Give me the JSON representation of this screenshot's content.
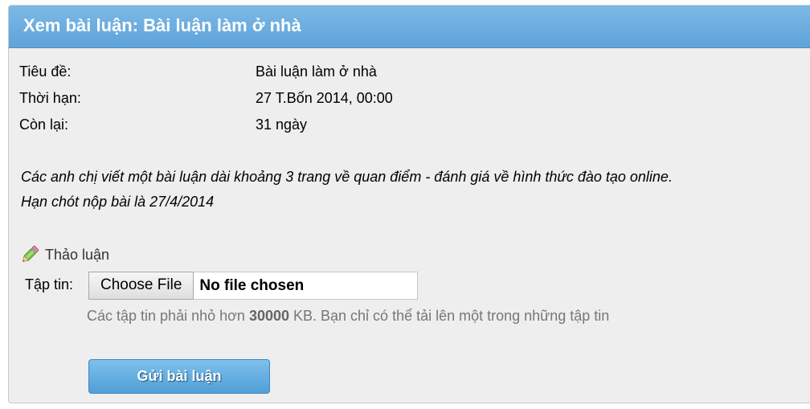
{
  "header": {
    "title": "Xem bài luận: Bài luận làm ở nhà"
  },
  "info": {
    "title_label": "Tiêu đề:",
    "title_value": "Bài luận làm ở nhà",
    "deadline_label": "Thời hạn:",
    "deadline_value": "27 T.Bốn 2014, 00:00",
    "remaining_label": "Còn lại:",
    "remaining_value": "31 ngày"
  },
  "description": {
    "line1": "Các anh chị viết một bài luận dài khoảng 3 trang về quan điểm - đánh giá về hình thức đào tạo online.",
    "line2": "Hạn chót nộp bài là 27/4/2014"
  },
  "discussion": {
    "label": "Thảo luận",
    "icon": "pencil-icon"
  },
  "file_upload": {
    "label": "Tập tin:",
    "button_label": "Choose File",
    "status": "No file chosen",
    "hint_prefix": "Các tập tin phải nhỏ hơn ",
    "hint_size": "30000",
    "hint_suffix": " KB. Bạn chỉ có thể tải lên một trong những tập tin"
  },
  "submit": {
    "label": "Gửi bài luận"
  },
  "colors": {
    "header_bg": "#6aaee0",
    "panel_bg": "#eeeeee",
    "button_bg": "#5aa8dc"
  }
}
